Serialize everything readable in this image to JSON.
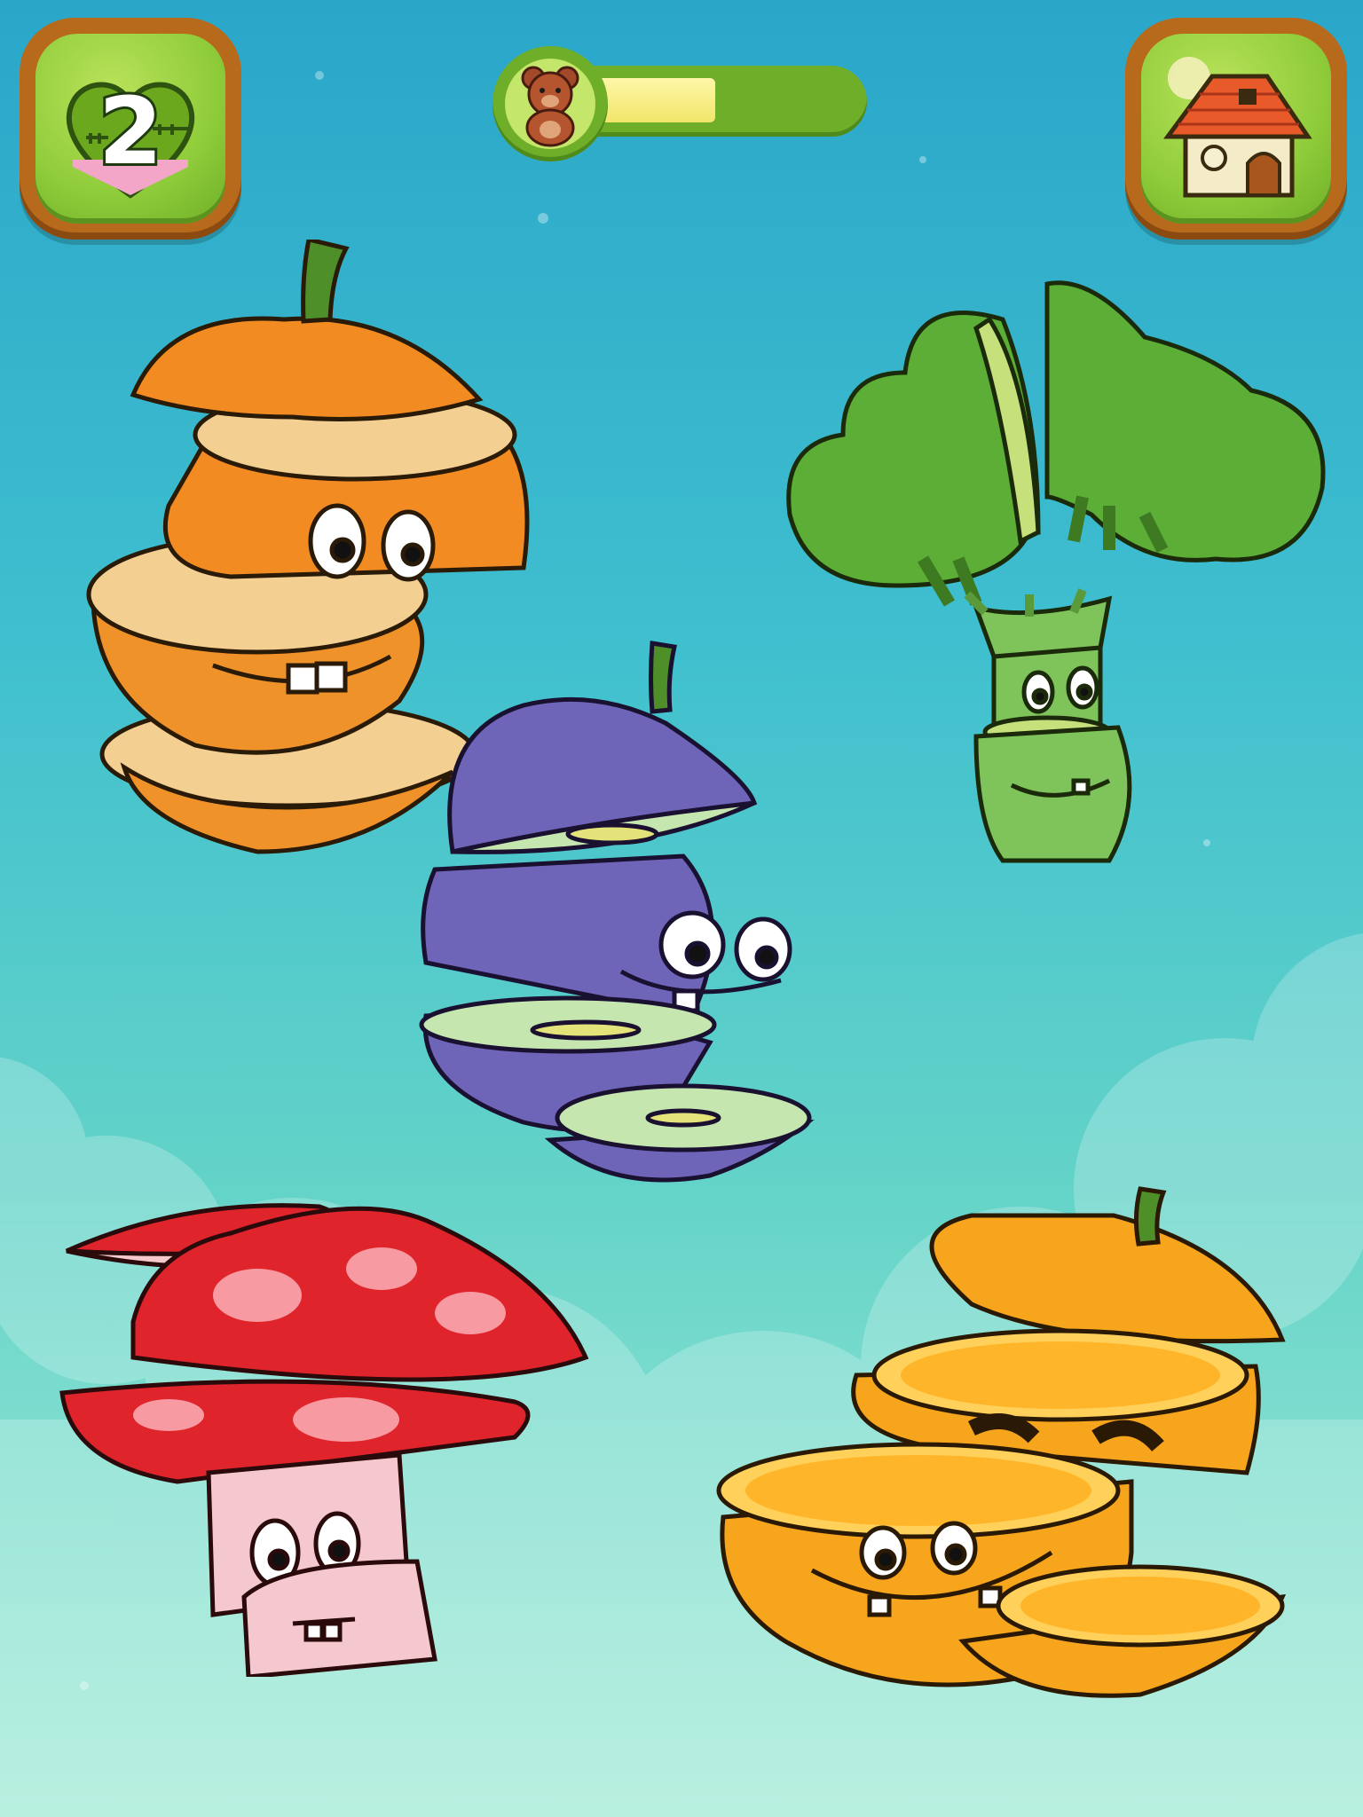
{
  "hud": {
    "lives": {
      "count": "2",
      "icon": "heart-icon"
    },
    "progress": {
      "fraction": 0.5,
      "avatar_icon": "teddy-bear-icon"
    },
    "home": {
      "icon": "house-icon"
    }
  },
  "colors": {
    "sky_top": "#2aa6c9",
    "sky_bottom": "#a6ecd8",
    "button_frame": "#b86a1c",
    "button_face": "#8fcc3a",
    "progress_fill": "#f1e56a"
  },
  "characters": [
    {
      "name": "pumpkin",
      "color": "#f0922a"
    },
    {
      "name": "broccoli",
      "color": "#5cae36"
    },
    {
      "name": "plum",
      "color": "#6e64b8"
    },
    {
      "name": "mushroom",
      "color": "#e0242c"
    },
    {
      "name": "orange",
      "color": "#f7a51c"
    }
  ]
}
